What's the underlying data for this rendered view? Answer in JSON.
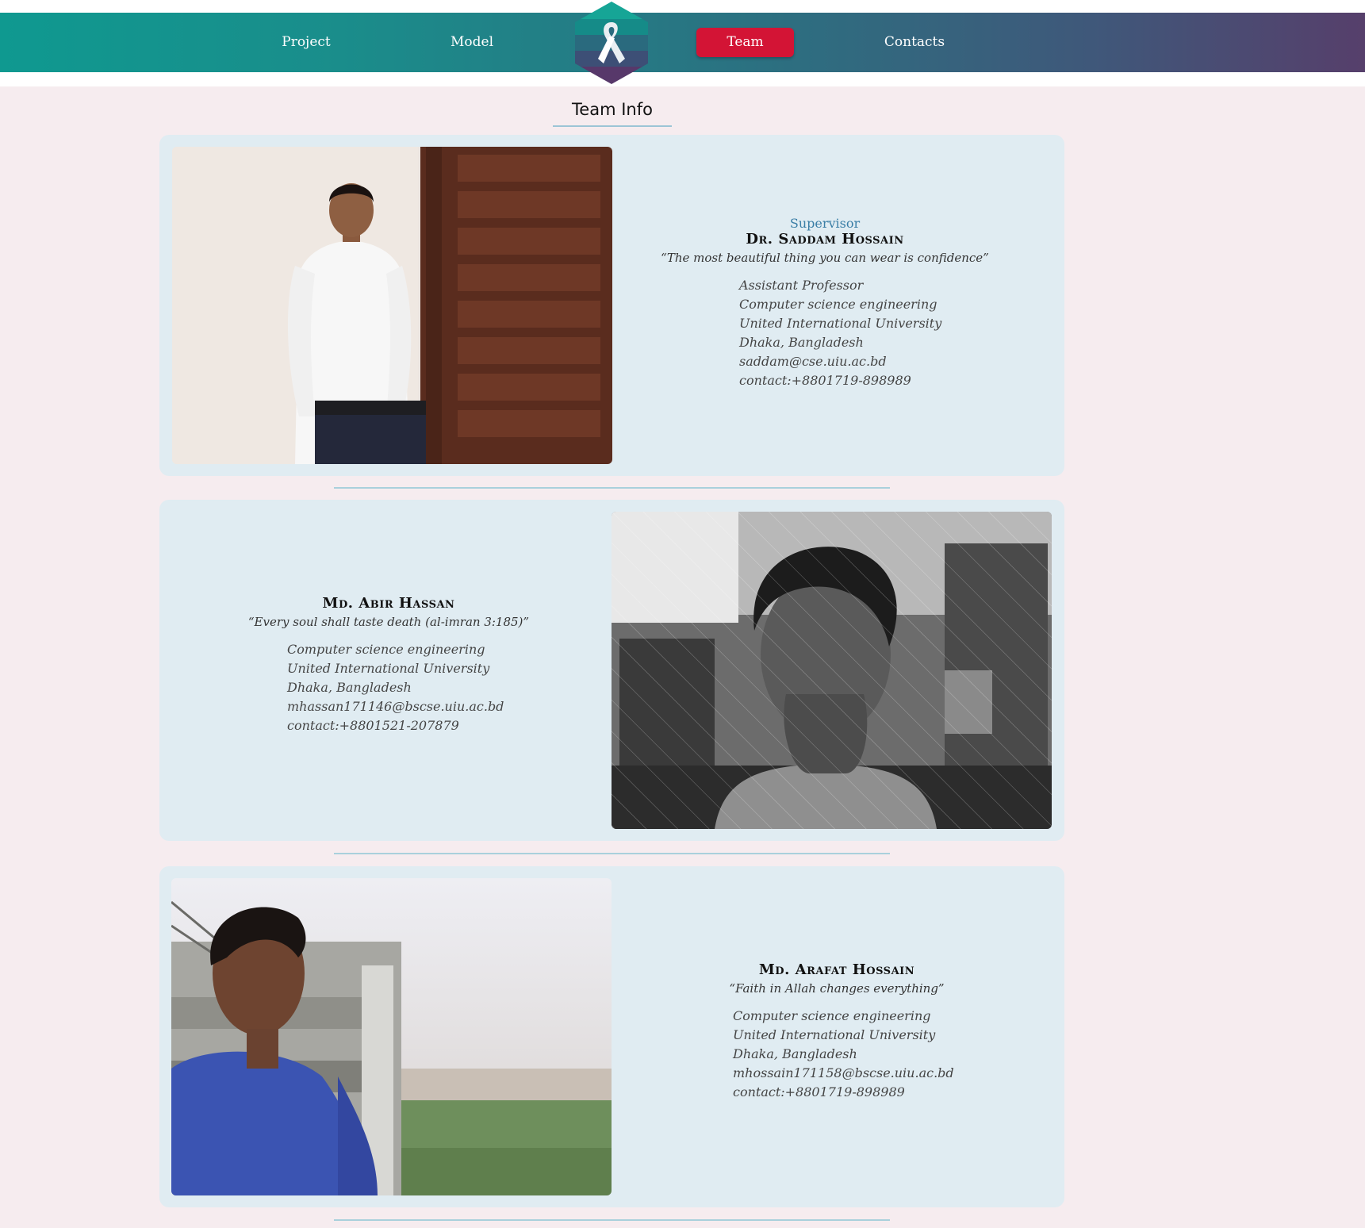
{
  "nav": {
    "items": [
      "Project",
      "Model",
      "Team",
      "Contacts"
    ],
    "active": "Team",
    "logo_icon": "awareness-ribbon-icon"
  },
  "page": {
    "title": "Team Info"
  },
  "members": [
    {
      "role": "Supervisor",
      "name": "Dr. Saddam Hossain",
      "quote": "“The most beautiful thing you can wear is confidence”",
      "details": [
        "Assistant Professor",
        "Computer science engineering",
        "United International University",
        "Dhaka, Bangladesh",
        "saddam@cse.uiu.ac.bd",
        "contact:+8801719-898989"
      ]
    },
    {
      "role": "",
      "name": "Md. Abir Hassan",
      "quote": "“Every soul shall taste death (al-imran 3:185)”",
      "details": [
        "Computer science engineering",
        "United International University",
        "Dhaka, Bangladesh",
        "mhassan171146@bscse.uiu.ac.bd",
        "contact:+8801521-207879"
      ]
    },
    {
      "role": "",
      "name": "Md. Arafat Hossain",
      "quote": "“Faith in Allah changes everything”",
      "details": [
        "Computer science engineering",
        "United International University",
        "Dhaka, Bangladesh",
        "mhossain171158@bscse.uiu.ac.bd",
        "contact:+8801719-898989"
      ]
    }
  ],
  "colors": {
    "background": "#f6ecef",
    "card": "#e0ecf2",
    "nav_start": "#0f9990",
    "nav_end": "#563f6b",
    "active": "#d31435",
    "role": "#3a7ea6"
  }
}
